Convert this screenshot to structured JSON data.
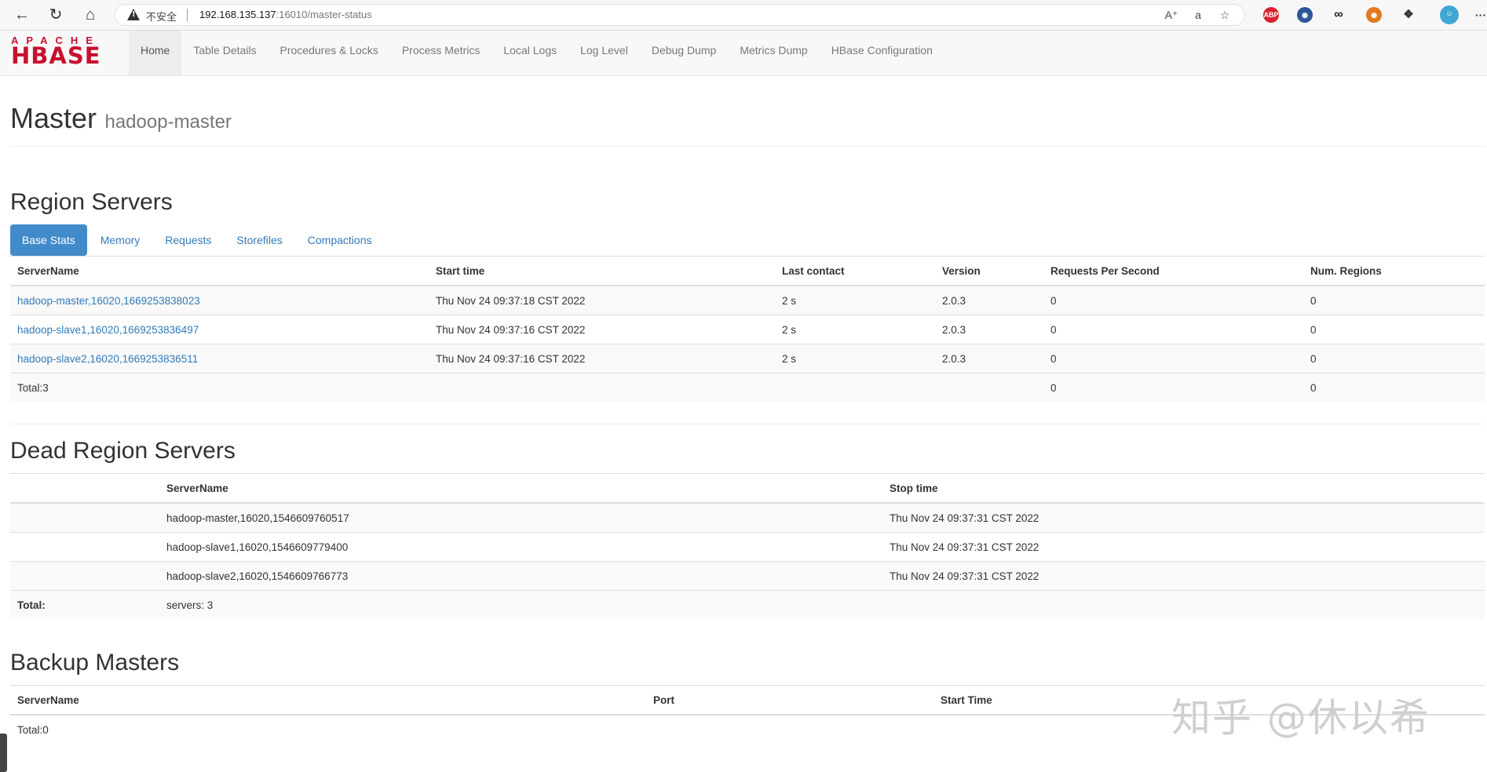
{
  "browser": {
    "insecure_label": "不安全",
    "url_host": "192.168.135.137",
    "url_rest": ":16010/master-status",
    "icons": [
      "back-icon",
      "refresh-icon",
      "home-icon",
      "warning-icon",
      "read-aloud-icon",
      "translate-icon",
      "favorite-icon",
      "abp-icon",
      "extension-icon",
      "infinity-icon",
      "tiger-icon",
      "puzzle-icon",
      "profile-icon",
      "more-icon"
    ],
    "ext_abp": "ABP",
    "more": "···"
  },
  "navbar": {
    "logo_top": "APACHE",
    "logo_main": "HBASE",
    "links": [
      "Home",
      "Table Details",
      "Procedures & Locks",
      "Process Metrics",
      "Local Logs",
      "Log Level",
      "Debug Dump",
      "Metrics Dump",
      "HBase Configuration"
    ]
  },
  "header": {
    "title": "Master",
    "subtitle": "hadoop-master"
  },
  "region_servers": {
    "title": "Region Servers",
    "tabs": [
      "Base Stats",
      "Memory",
      "Requests",
      "Storefiles",
      "Compactions"
    ],
    "columns": [
      "ServerName",
      "Start time",
      "Last contact",
      "Version",
      "Requests Per Second",
      "Num. Regions"
    ],
    "rows": [
      [
        "hadoop-master,16020,1669253838023",
        "Thu Nov 24 09:37:18 CST 2022",
        "2 s",
        "2.0.3",
        "0",
        "0"
      ],
      [
        "hadoop-slave1,16020,1669253836497",
        "Thu Nov 24 09:37:16 CST 2022",
        "2 s",
        "2.0.3",
        "0",
        "0"
      ],
      [
        "hadoop-slave2,16020,1669253836511",
        "Thu Nov 24 09:37:16 CST 2022",
        "2 s",
        "2.0.3",
        "0",
        "0"
      ]
    ],
    "total_label": "Total:3",
    "total_rps": "0",
    "total_regions": "0"
  },
  "dead_region_servers": {
    "title": "Dead Region Servers",
    "columns": [
      "ServerName",
      "Stop time"
    ],
    "rows": [
      [
        "hadoop-master,16020,1546609760517",
        "Thu Nov 24 09:37:31 CST 2022"
      ],
      [
        "hadoop-slave1,16020,1546609779400",
        "Thu Nov 24 09:37:31 CST 2022"
      ],
      [
        "hadoop-slave2,16020,1546609766773",
        "Thu Nov 24 09:37:31 CST 2022"
      ]
    ],
    "total_label": "Total:",
    "total_value": "servers: 3"
  },
  "backup_masters": {
    "title": "Backup Masters",
    "columns": [
      "ServerName",
      "Port",
      "Start Time"
    ],
    "total_label": "Total:0"
  },
  "watermark": "知乎 @休以希",
  "colors": {
    "link": "#337ab7",
    "active_tab": "#428bca",
    "logo": "#c8102e"
  }
}
